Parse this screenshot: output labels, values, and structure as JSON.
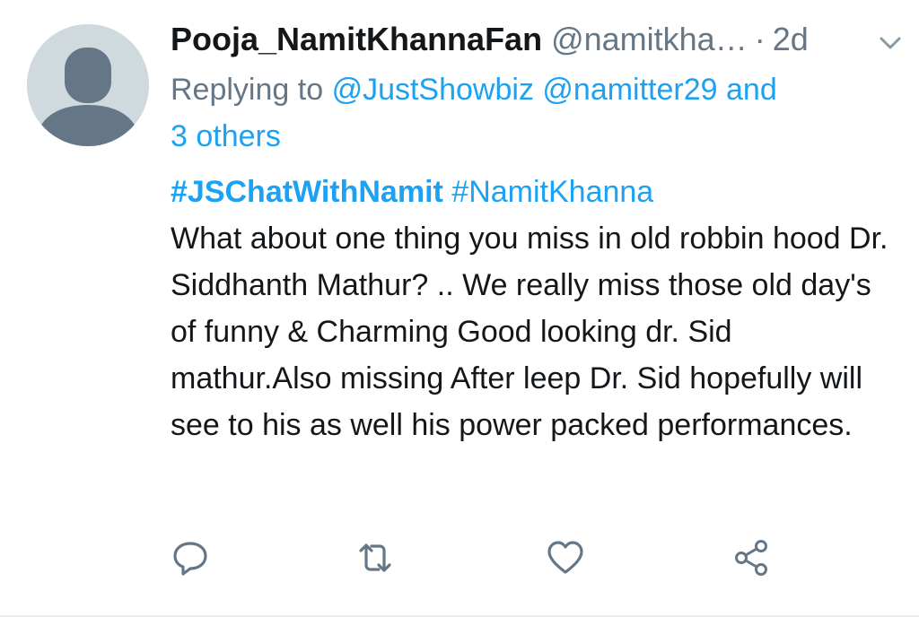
{
  "tweet": {
    "display_name": "Pooja_NamitKhannaFan",
    "handle": "@namitkha…",
    "separator": "·",
    "time": "2d",
    "replying_prefix": "Replying to",
    "replying_user1": "@JustShowbiz",
    "replying_user2": "@namitter29",
    "replying_and": "and",
    "replying_others": "3 others",
    "hashtag1": "#JSChatWithNamit",
    "hashtag2": "#NamitKhanna",
    "body": "What about one thing you miss in old robbin hood Dr. Siddhanth Mathur? .. We really miss those old day's of funny & Charming Good looking dr. Sid mathur.Also missing After leep Dr. Sid hopefully will see to his as well his power packed performances."
  },
  "icons": {
    "avatar": "default-avatar-icon",
    "caret": "chevron-down-icon",
    "reply": "reply-icon",
    "retweet": "retweet-icon",
    "like": "heart-icon",
    "share": "share-icon"
  },
  "colors": {
    "link": "#1da1f2",
    "text": "#14171a",
    "muted": "#657786",
    "avatar_bg": "#cfd9de",
    "avatar_fg": "#657786"
  }
}
